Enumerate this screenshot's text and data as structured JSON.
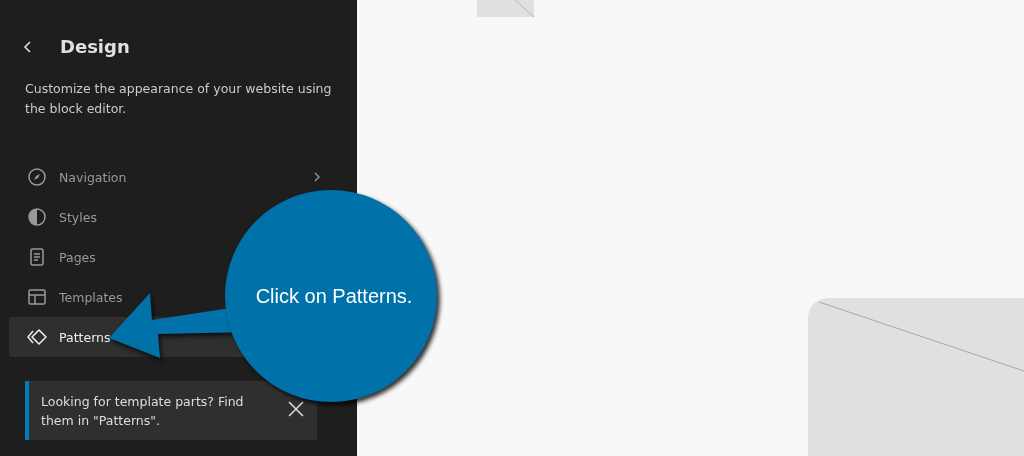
{
  "sidebar": {
    "title": "Design",
    "description": "Customize the appearance of your website using the block editor.",
    "items": [
      {
        "label": "Navigation",
        "selected": false,
        "expandable": true
      },
      {
        "label": "Styles",
        "selected": false
      },
      {
        "label": "Pages",
        "selected": false
      },
      {
        "label": "Templates",
        "selected": false
      },
      {
        "label": "Patterns",
        "selected": true
      }
    ],
    "notice": {
      "text": "Looking for template parts? Find them in \"Patterns\"."
    }
  },
  "callout": {
    "text": "Click on Patterns."
  }
}
